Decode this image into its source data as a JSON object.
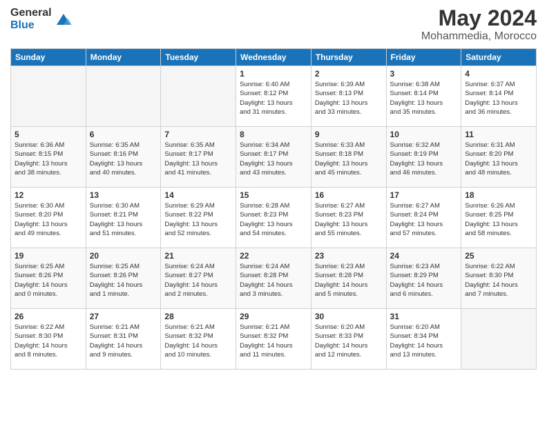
{
  "logo": {
    "general": "General",
    "blue": "Blue"
  },
  "header": {
    "month_year": "May 2024",
    "location": "Mohammedia, Morocco"
  },
  "days_of_week": [
    "Sunday",
    "Monday",
    "Tuesday",
    "Wednesday",
    "Thursday",
    "Friday",
    "Saturday"
  ],
  "weeks": [
    [
      {
        "day": "",
        "content": ""
      },
      {
        "day": "",
        "content": ""
      },
      {
        "day": "",
        "content": ""
      },
      {
        "day": "1",
        "content": "Sunrise: 6:40 AM\nSunset: 8:12 PM\nDaylight: 13 hours\nand 31 minutes."
      },
      {
        "day": "2",
        "content": "Sunrise: 6:39 AM\nSunset: 8:13 PM\nDaylight: 13 hours\nand 33 minutes."
      },
      {
        "day": "3",
        "content": "Sunrise: 6:38 AM\nSunset: 8:14 PM\nDaylight: 13 hours\nand 35 minutes."
      },
      {
        "day": "4",
        "content": "Sunrise: 6:37 AM\nSunset: 8:14 PM\nDaylight: 13 hours\nand 36 minutes."
      }
    ],
    [
      {
        "day": "5",
        "content": "Sunrise: 6:36 AM\nSunset: 8:15 PM\nDaylight: 13 hours\nand 38 minutes."
      },
      {
        "day": "6",
        "content": "Sunrise: 6:35 AM\nSunset: 8:16 PM\nDaylight: 13 hours\nand 40 minutes."
      },
      {
        "day": "7",
        "content": "Sunrise: 6:35 AM\nSunset: 8:17 PM\nDaylight: 13 hours\nand 41 minutes."
      },
      {
        "day": "8",
        "content": "Sunrise: 6:34 AM\nSunset: 8:17 PM\nDaylight: 13 hours\nand 43 minutes."
      },
      {
        "day": "9",
        "content": "Sunrise: 6:33 AM\nSunset: 8:18 PM\nDaylight: 13 hours\nand 45 minutes."
      },
      {
        "day": "10",
        "content": "Sunrise: 6:32 AM\nSunset: 8:19 PM\nDaylight: 13 hours\nand 46 minutes."
      },
      {
        "day": "11",
        "content": "Sunrise: 6:31 AM\nSunset: 8:20 PM\nDaylight: 13 hours\nand 48 minutes."
      }
    ],
    [
      {
        "day": "12",
        "content": "Sunrise: 6:30 AM\nSunset: 8:20 PM\nDaylight: 13 hours\nand 49 minutes."
      },
      {
        "day": "13",
        "content": "Sunrise: 6:30 AM\nSunset: 8:21 PM\nDaylight: 13 hours\nand 51 minutes."
      },
      {
        "day": "14",
        "content": "Sunrise: 6:29 AM\nSunset: 8:22 PM\nDaylight: 13 hours\nand 52 minutes."
      },
      {
        "day": "15",
        "content": "Sunrise: 6:28 AM\nSunset: 8:23 PM\nDaylight: 13 hours\nand 54 minutes."
      },
      {
        "day": "16",
        "content": "Sunrise: 6:27 AM\nSunset: 8:23 PM\nDaylight: 13 hours\nand 55 minutes."
      },
      {
        "day": "17",
        "content": "Sunrise: 6:27 AM\nSunset: 8:24 PM\nDaylight: 13 hours\nand 57 minutes."
      },
      {
        "day": "18",
        "content": "Sunrise: 6:26 AM\nSunset: 8:25 PM\nDaylight: 13 hours\nand 58 minutes."
      }
    ],
    [
      {
        "day": "19",
        "content": "Sunrise: 6:25 AM\nSunset: 8:26 PM\nDaylight: 14 hours\nand 0 minutes."
      },
      {
        "day": "20",
        "content": "Sunrise: 6:25 AM\nSunset: 8:26 PM\nDaylight: 14 hours\nand 1 minute."
      },
      {
        "day": "21",
        "content": "Sunrise: 6:24 AM\nSunset: 8:27 PM\nDaylight: 14 hours\nand 2 minutes."
      },
      {
        "day": "22",
        "content": "Sunrise: 6:24 AM\nSunset: 8:28 PM\nDaylight: 14 hours\nand 3 minutes."
      },
      {
        "day": "23",
        "content": "Sunrise: 6:23 AM\nSunset: 8:28 PM\nDaylight: 14 hours\nand 5 minutes."
      },
      {
        "day": "24",
        "content": "Sunrise: 6:23 AM\nSunset: 8:29 PM\nDaylight: 14 hours\nand 6 minutes."
      },
      {
        "day": "25",
        "content": "Sunrise: 6:22 AM\nSunset: 8:30 PM\nDaylight: 14 hours\nand 7 minutes."
      }
    ],
    [
      {
        "day": "26",
        "content": "Sunrise: 6:22 AM\nSunset: 8:30 PM\nDaylight: 14 hours\nand 8 minutes."
      },
      {
        "day": "27",
        "content": "Sunrise: 6:21 AM\nSunset: 8:31 PM\nDaylight: 14 hours\nand 9 minutes."
      },
      {
        "day": "28",
        "content": "Sunrise: 6:21 AM\nSunset: 8:32 PM\nDaylight: 14 hours\nand 10 minutes."
      },
      {
        "day": "29",
        "content": "Sunrise: 6:21 AM\nSunset: 8:32 PM\nDaylight: 14 hours\nand 11 minutes."
      },
      {
        "day": "30",
        "content": "Sunrise: 6:20 AM\nSunset: 8:33 PM\nDaylight: 14 hours\nand 12 minutes."
      },
      {
        "day": "31",
        "content": "Sunrise: 6:20 AM\nSunset: 8:34 PM\nDaylight: 14 hours\nand 13 minutes."
      },
      {
        "day": "",
        "content": ""
      }
    ]
  ]
}
